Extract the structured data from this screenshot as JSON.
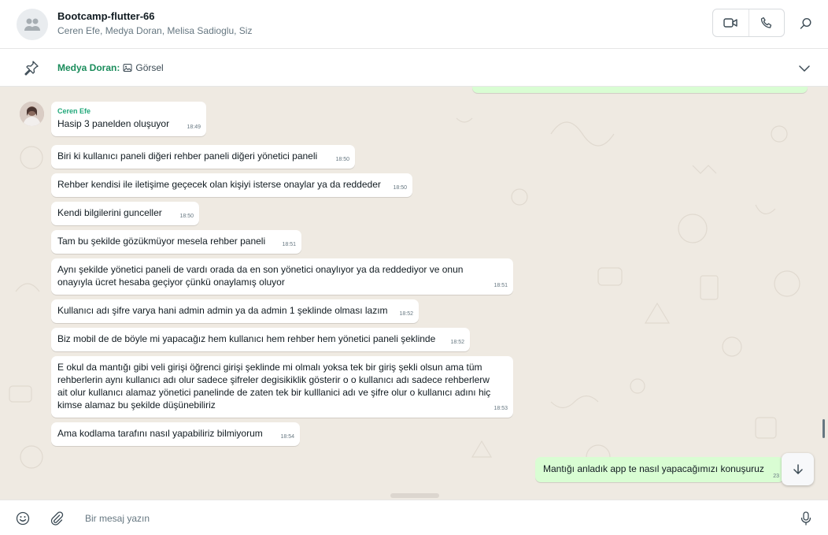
{
  "header": {
    "title": "Bootcamp-flutter-66",
    "participants": "Ceren Efe, Medya Doran, Melisa Sadioglu, Siz"
  },
  "pinned": {
    "sender": "Medya Doran:",
    "body": "Görsel"
  },
  "messages": [
    {
      "sender": "Ceren Efe",
      "text": "Hasip 3 panelden oluşuyor",
      "time": "18:49"
    },
    {
      "text": "Biri ki kullanıcı paneli diğeri rehber paneli diğeri yönetici paneli",
      "time": "18:50"
    },
    {
      "text": "Rehber kendisi ile iletişime geçecek olan kişiyi isterse onaylar ya da reddeder",
      "time": "18:50"
    },
    {
      "text": "Kendi bilgilerini gunceller",
      "time": "18:50"
    },
    {
      "text": "Tam bu şekilde gözükmüyor mesela rehber paneli",
      "time": "18:51"
    },
    {
      "text": "Aynı şekilde yönetici paneli de vardı orada da en son yönetici onaylıyor ya da reddediyor ve onun onayıyla ücret hesaba geçiyor çünkü onaylamış oluyor",
      "time": "18:51"
    },
    {
      "text": "Kullanıcı adı şifre varya hani admin admin ya da admin 1 şeklinde olması lazım",
      "time": "18:52"
    },
    {
      "text": "Biz mobil de de böyle mi yapacağız hem kullanıcı hem rehber hem yönetici paneli şeklinde",
      "time": "18:52"
    },
    {
      "text": "E okul da mantığı gibi veli girişi öğrenci girişi şeklinde mi olmalı yoksa tek bir giriş şekli olsun ama tüm rehberlerin aynı kullanıcı adı olur sadece şifreler degisikiklik gösterir o o kullanıcı adı sadece rehberlerw ait olur kullanıcı alamaz yönetici panelinde de zaten tek bir kulllanici adı ve şifre olur o kullanıcı adını hiç kimse alamaz bu şekilde düşünebiliriz",
      "time": "18:53"
    },
    {
      "text": "Ama kodlama tarafını nasıl yapabiliriz bilmiyorum",
      "time": "18:54"
    }
  ],
  "sent_message": {
    "text": "Mantığı anladık app te nasıl yapacağımızı konuşuruz",
    "time": "23"
  },
  "composer": {
    "placeholder": "Bir mesaj yazın"
  },
  "icons": {
    "group_avatar": "group-icon",
    "video": "video-call-icon",
    "voice": "phone-icon",
    "search": "search-icon",
    "pin": "pin-icon",
    "image": "image-icon",
    "expand": "chevron-down-icon",
    "scroll": "arrow-down-icon",
    "emoji": "emoji-icon",
    "attach": "paperclip-icon",
    "mic": "microphone-icon"
  },
  "colors": {
    "sender_name": "#21a87a",
    "pinned_sender": "#1a8c5b",
    "outgoing_bubble": "#d9fdd3",
    "chat_background": "#efeae2"
  }
}
